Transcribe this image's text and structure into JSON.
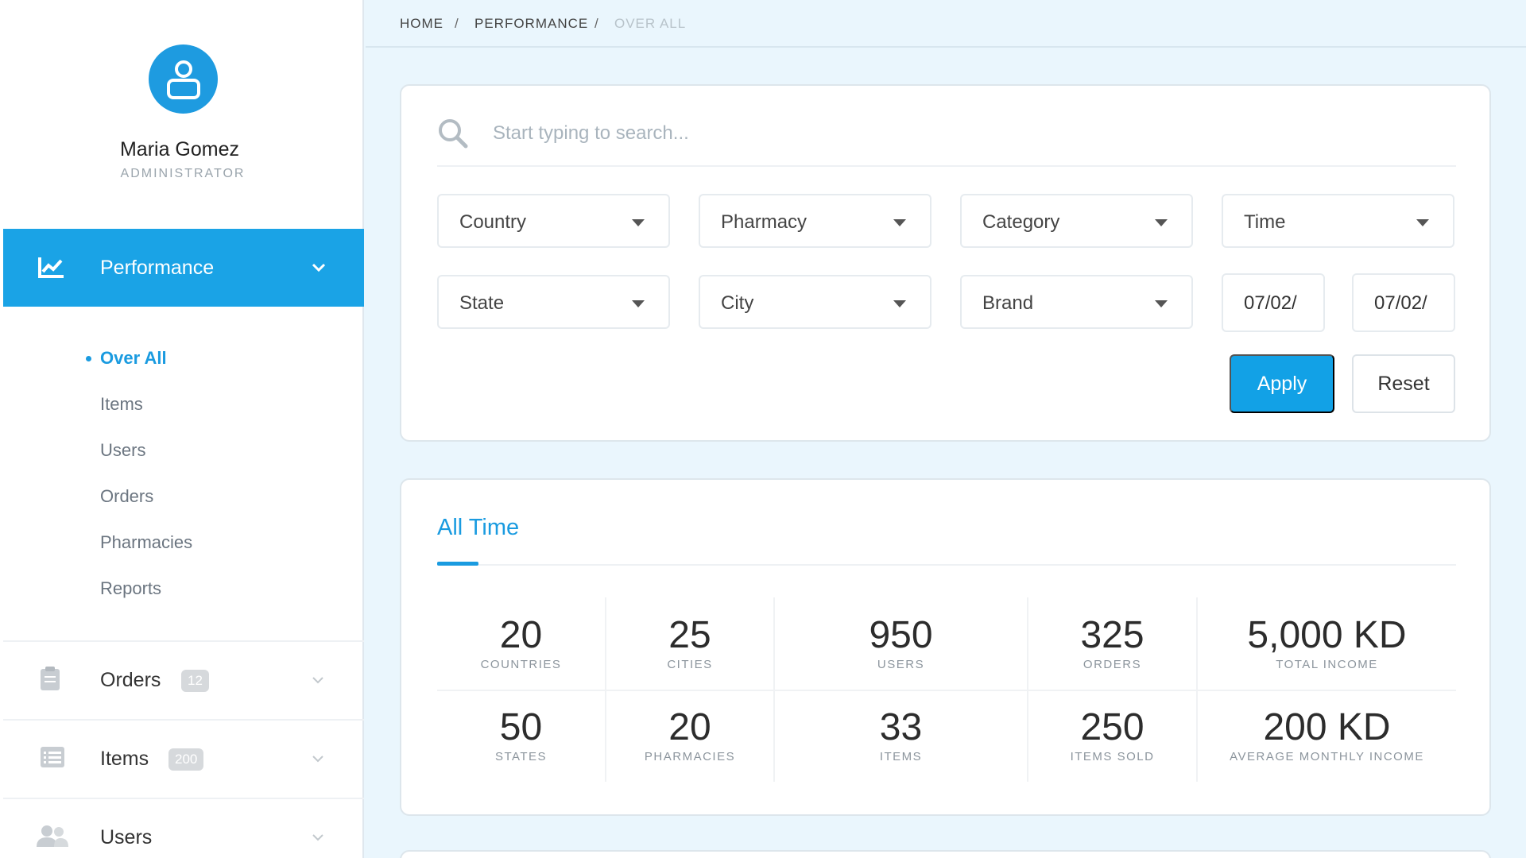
{
  "profile": {
    "name": "Maria Gomez",
    "role": "ADMINISTRATOR"
  },
  "sidebar": {
    "active_section": "Performance",
    "sub_items": [
      "Over All",
      "Items",
      "Users",
      "Orders",
      "Pharmacies",
      "Reports"
    ],
    "sections": [
      {
        "label": "Orders",
        "badge": "12",
        "icon": "clipboard-icon"
      },
      {
        "label": "Items",
        "badge": "200",
        "icon": "list-icon"
      },
      {
        "label": "Users",
        "badge": "",
        "icon": "users-icon"
      }
    ]
  },
  "breadcrumb": [
    "HOME",
    "PERFORMANCE",
    "OVER ALL"
  ],
  "search": {
    "placeholder": "Start typing to search..."
  },
  "filters": {
    "country": "Country",
    "pharmacy": "Pharmacy",
    "category": "Category",
    "time": "Time",
    "state": "State",
    "city": "City",
    "brand": "Brand",
    "date_from": "07/02/",
    "date_to": "07/02/"
  },
  "actions": {
    "apply": "Apply",
    "reset": "Reset"
  },
  "stats": {
    "tab": "All Time",
    "row1": [
      {
        "value": "20",
        "label": "COUNTRIES"
      },
      {
        "value": "25",
        "label": "CITIES"
      },
      {
        "value": "950",
        "label": "USERS"
      },
      {
        "value": "325",
        "label": "ORDERS"
      },
      {
        "value": "5,000 KD",
        "label": "TOTAL INCOME"
      }
    ],
    "row2": [
      {
        "value": "50",
        "label": "STATES"
      },
      {
        "value": "20",
        "label": "PHARMACIES"
      },
      {
        "value": "33",
        "label": "ITEMS"
      },
      {
        "value": "250",
        "label": "ITEMS SOLD"
      },
      {
        "value": "200 KD",
        "label": "AVERAGE MONTHLY INCOME"
      }
    ]
  },
  "colors": {
    "accent": "#1aa3e6",
    "background": "#eaf6fd"
  }
}
